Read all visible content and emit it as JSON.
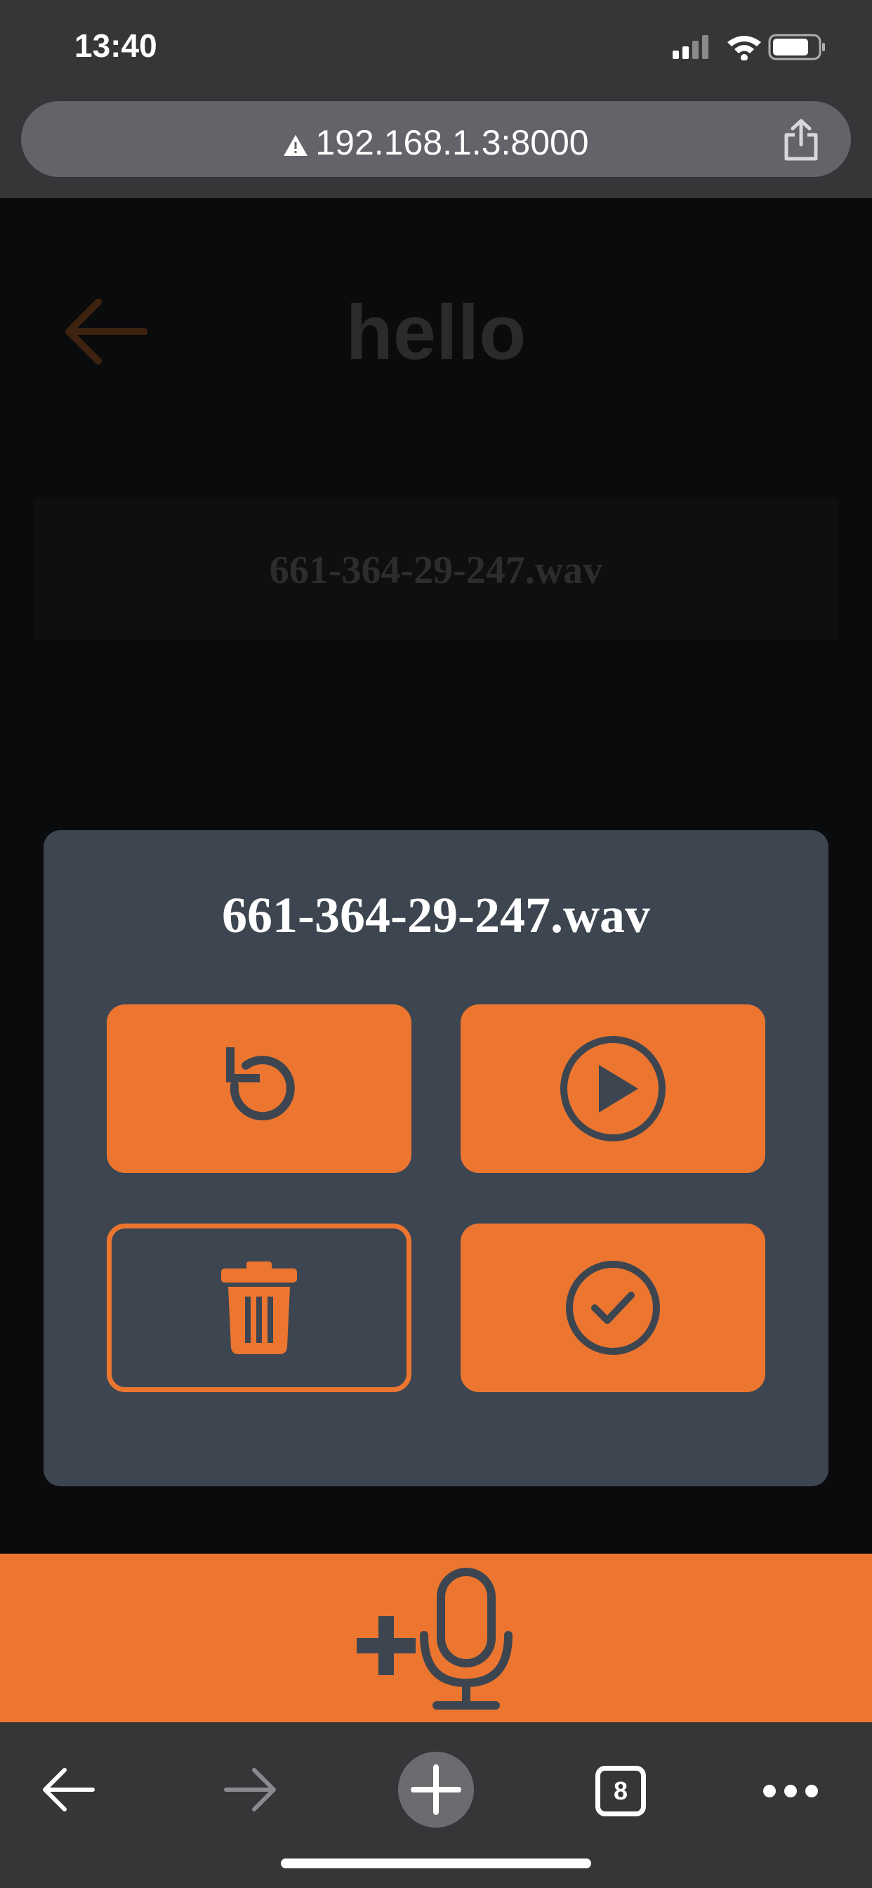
{
  "status_bar": {
    "time": "13:40"
  },
  "browser": {
    "url": "192.168.1.3:8000",
    "open_tab_count": "8"
  },
  "page": {
    "title": "hello",
    "background_file_label": "661-364-29-247.wav"
  },
  "modal": {
    "file_name": "661-364-29-247.wav"
  },
  "colors": {
    "accent": "#ec7630",
    "modal_bg": "#3d4650",
    "chrome_bg": "#353638",
    "page_bg": "#0a0b0d"
  },
  "icons": {
    "redo": "rotate-ccw-icon",
    "play": "play-circle-icon",
    "delete": "trash-icon",
    "confirm": "check-circle-icon",
    "record": "add-microphone-icon"
  }
}
